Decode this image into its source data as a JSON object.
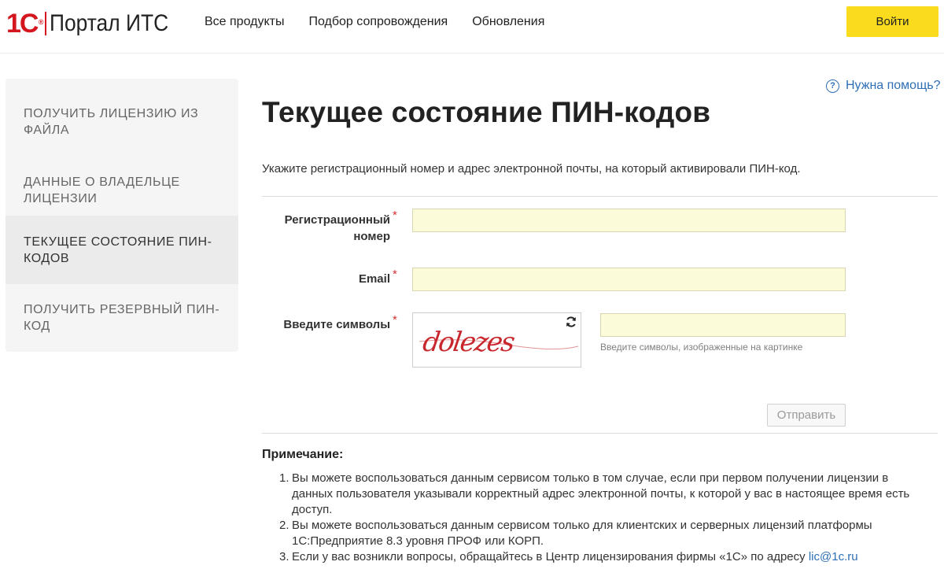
{
  "header": {
    "logo_mark": "1С",
    "logo_reg": "®",
    "logo_text": "Портал ИТС",
    "nav": [
      "Все продукты",
      "Подбор сопровождения",
      "Обновления"
    ],
    "login_label": "Войти"
  },
  "sidebar": {
    "items": [
      {
        "label": "Получить лицензию из файла",
        "active": false
      },
      {
        "label": "Данные о владельце лицензии",
        "active": false
      },
      {
        "label": "Текущее состояние ПИН-кодов",
        "active": true
      },
      {
        "label": "Получить резервный ПИН-код",
        "active": false
      }
    ]
  },
  "help_label": "Нужна помощь?",
  "page_title": "Текущее состояние ПИН-кодов",
  "intro": "Укажите регистрационный номер и адрес электронной почты, на который активировали ПИН-код.",
  "form": {
    "reg_label_1": "Регистрационный",
    "reg_label_2": "номер",
    "email_label": "Email",
    "captcha_label": "Введите символы",
    "required_mark": "*",
    "reg_value": "",
    "email_value": "",
    "captcha_value": "",
    "captcha_text": "dolezes",
    "captcha_hint": "Введите символы, изображенные на картинке",
    "submit_label": "Отправить"
  },
  "notes": {
    "title": "Примечание:",
    "items": [
      {
        "num": "1.",
        "text": "Вы можете воспользоваться данным сервисом только в том случае, если при первом получении лицензии в данных пользователя указывали корректный адрес электронной почты, к которой у вас в настоящее время есть доступ."
      },
      {
        "num": "2.",
        "text": "Вы можете воспользоваться данным сервисом только для клиентских и серверных лицензий платформы 1С:Предприятие 8.3 уровня ПРОФ или КОРП."
      },
      {
        "num": "3.",
        "text": "Если у вас возникли вопросы, обращайтесь в Центр лицензирования фирмы «1С» по адресу ",
        "link": "lic@1c.ru"
      }
    ]
  },
  "colors": {
    "brand_red": "#d4171e",
    "login_yellow": "#fbdb1d",
    "link_blue": "#2f6fb5",
    "field_bg": "#fbfad9",
    "captcha_red": "#c8282d"
  }
}
